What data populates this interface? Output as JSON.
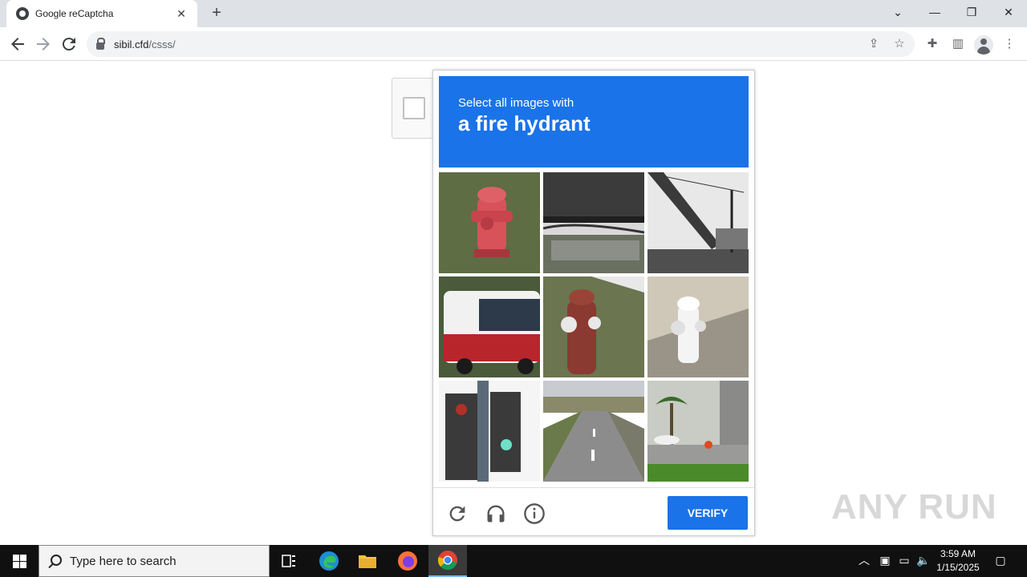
{
  "browser": {
    "tab_title": "Google reCaptcha",
    "tab_close": "✕",
    "new_tab": "+",
    "url_host": "sibil.cfd",
    "url_path": "/csss/",
    "window_controls": {
      "list": "⌄",
      "minimize": "—",
      "restore": "❐",
      "close": "✕"
    }
  },
  "captcha": {
    "prompt": "Select all images with",
    "target": "a fire hydrant",
    "verify_label": "VERIFY",
    "tiles": [
      "fire hydrant",
      "bridge",
      "overpass",
      "bus",
      "fire hydrant",
      "fire hydrant",
      "traffic light",
      "road",
      "street with palm trees"
    ]
  },
  "watermark": "ANY RUN",
  "taskbar": {
    "search_placeholder": "Type here to search",
    "time": "3:59 AM",
    "date": "1/15/2025"
  },
  "colors": {
    "accent": "#1a73e8",
    "taskbar": "#101010"
  }
}
